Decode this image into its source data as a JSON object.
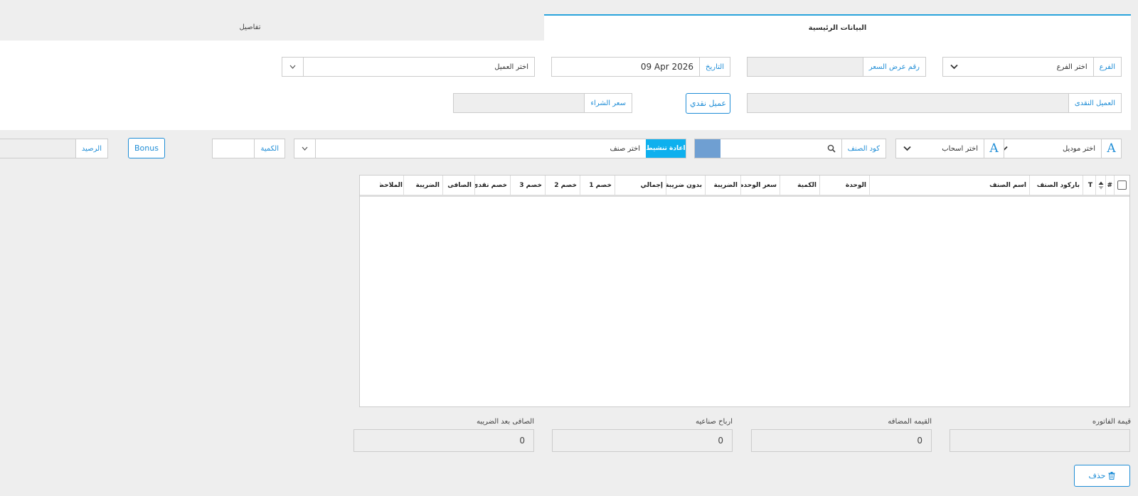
{
  "tabs": {
    "main": "البيانات الرئيسية",
    "details": "تفاصيل"
  },
  "form": {
    "branch_label": "الفرع",
    "branch_value": "اختر الفرع",
    "quote_label": "رقم عرض السعر",
    "date_label": "التاريخ",
    "date_value": "09 Apr 2026",
    "customer_placeholder": "اختر العميل",
    "cash_customer_label": "العميل النقدى",
    "cash_customer_button": "عميل نقدي",
    "purchase_price_label": "سعر الشراء"
  },
  "item_bar": {
    "model_value": "اختر موديل",
    "size_value": "اختر اسحاب",
    "item_code_label": "كود الصنف",
    "reactivate_button": "اعادة تنشيط",
    "item_value": "اختر صنف",
    "quantity_label": "الكمية",
    "bonus_button": "Bonus",
    "balance_label": "الرصيد"
  },
  "grid": {
    "columns": [
      "#",
      "T",
      "باركود الصنف",
      "اسم الصنف",
      "الوحدة",
      "الكمية",
      "سعر الوحده",
      "الضريبة",
      "بدون ضريبة",
      "إجمالي",
      "خصم 1",
      "خصم 2",
      "خصم 3",
      "خصم نقدى",
      "الصافى",
      "الضريبة",
      "الملاحظ"
    ]
  },
  "summary": {
    "invoice_value_label": "قيمة الفاتوره",
    "invoice_value": "",
    "vat_label": "القيمه المضافه",
    "vat_value": "0",
    "industrial_profit_label": "ارباح صناعيه",
    "industrial_profit_value": "0",
    "net_after_tax_label": "الصافى بعد الضريبه",
    "net_after_tax_value": "0"
  },
  "actions": {
    "delete_button": "حذف"
  },
  "colors": {
    "accent": "#1f8dd6",
    "cyan_button": "#0eb0ee",
    "panel": "#ffffff",
    "background": "#eeeeee"
  }
}
